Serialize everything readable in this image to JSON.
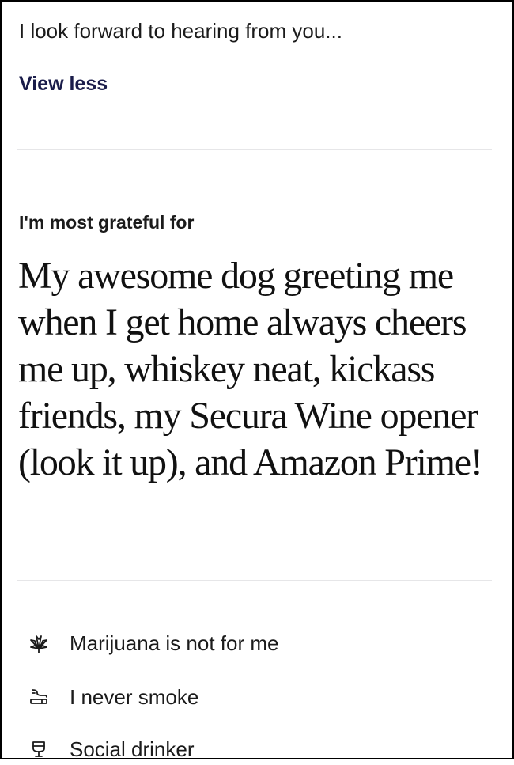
{
  "about": {
    "text": "I look forward to hearing from you...",
    "view_less_label": "View less"
  },
  "prompt": {
    "heading": "I'm most grateful for",
    "answer": "My awesome dog greeting me when I get home always cheers me up, whiskey neat, kickass friends, my Secura Wine opener (look it up), and Amazon Prime!"
  },
  "habits": [
    {
      "icon": "marijuana-leaf-icon",
      "label": "Marijuana is not for me"
    },
    {
      "icon": "smoking-icon",
      "label": "I never smoke"
    },
    {
      "icon": "drink-glass-icon",
      "label": "Social drinker"
    }
  ],
  "colors": {
    "text": "#1b1b1b",
    "link": "#1a1c4a",
    "divider": "#e6e6e8"
  }
}
